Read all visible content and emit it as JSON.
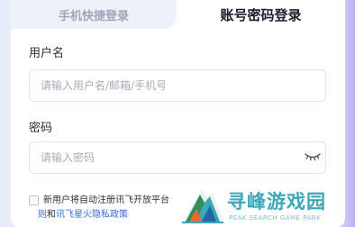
{
  "tabs": {
    "phone_login": "手机快捷登录",
    "account_login": "账号密码登录"
  },
  "form": {
    "username_label": "用户名",
    "username_placeholder": "请输入用户名/邮箱/手机号",
    "password_label": "密码",
    "password_placeholder": "请输入密码",
    "password_toggle_icon": "eye-closed-icon"
  },
  "agreement": {
    "text_line1": "新用户将自动注册讯飞开放平台",
    "link_rule": "则",
    "conj": "和",
    "link_privacy": "讯飞星火隐私政策"
  },
  "watermark": {
    "title": "寻峰游戏园",
    "subtitle": "PEAK SEARCH GAME PARK",
    "logo_icon": "mountain-logo-icon"
  },
  "colors": {
    "link": "#2f6ee6",
    "watermark": "#3da7b8",
    "accent_purple": "#b8aef0"
  }
}
